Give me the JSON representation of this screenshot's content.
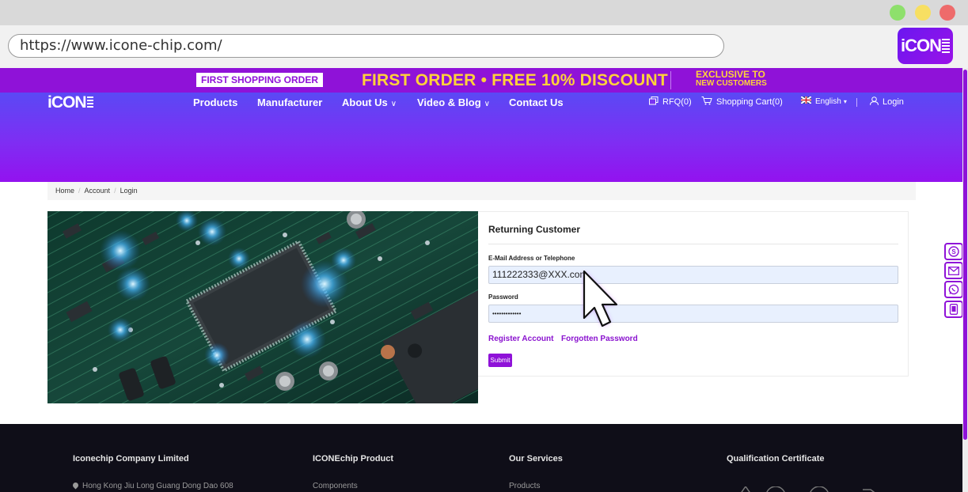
{
  "browser": {
    "url": "https://www.icone-chip.com/",
    "app_logo_text": "iCON"
  },
  "promo": {
    "badge": "FIRST SHOPPING ORDER",
    "main": "FIRST ORDER • FREE 10% DISCOUNT",
    "exclusive_line1": "EXCLUSIVE TO",
    "exclusive_line2": "NEW CUSTOMERS"
  },
  "header": {
    "logo": "iCON",
    "nav": [
      {
        "label": "Products"
      },
      {
        "label": "Manufacturer"
      },
      {
        "label": "About Us"
      },
      {
        "label": "Video & Blog"
      },
      {
        "label": "Contact Us"
      }
    ],
    "rfq": "RFQ(0)",
    "cart": "Shopping Cart(0)",
    "language": "English",
    "login": "Login"
  },
  "breadcrumb": [
    "Home",
    "Account",
    "Login"
  ],
  "login_form": {
    "title": "Returning Customer",
    "email_label": "E-Mail Address or Telephone",
    "email_value": "111222333@XXX.com",
    "password_label": "Password",
    "password_value": "•••••••••••••",
    "register_link": "Register Account",
    "forgot_link": "Forgotten Password",
    "submit_label": "Submit"
  },
  "footer": {
    "col1_title": "Iconechip Company Limited",
    "col1_text": "Hong Kong Jiu Long Guang Dong Dao 608",
    "col2_title": "ICONEchip Product",
    "col2_text": "Components",
    "col3_title": "Our Services",
    "col3_text": "Products",
    "col4_title": "Qualification Certificate"
  },
  "colors": {
    "brand_purple": "#8f12d8",
    "promo_yellow": "#ffd23a"
  }
}
